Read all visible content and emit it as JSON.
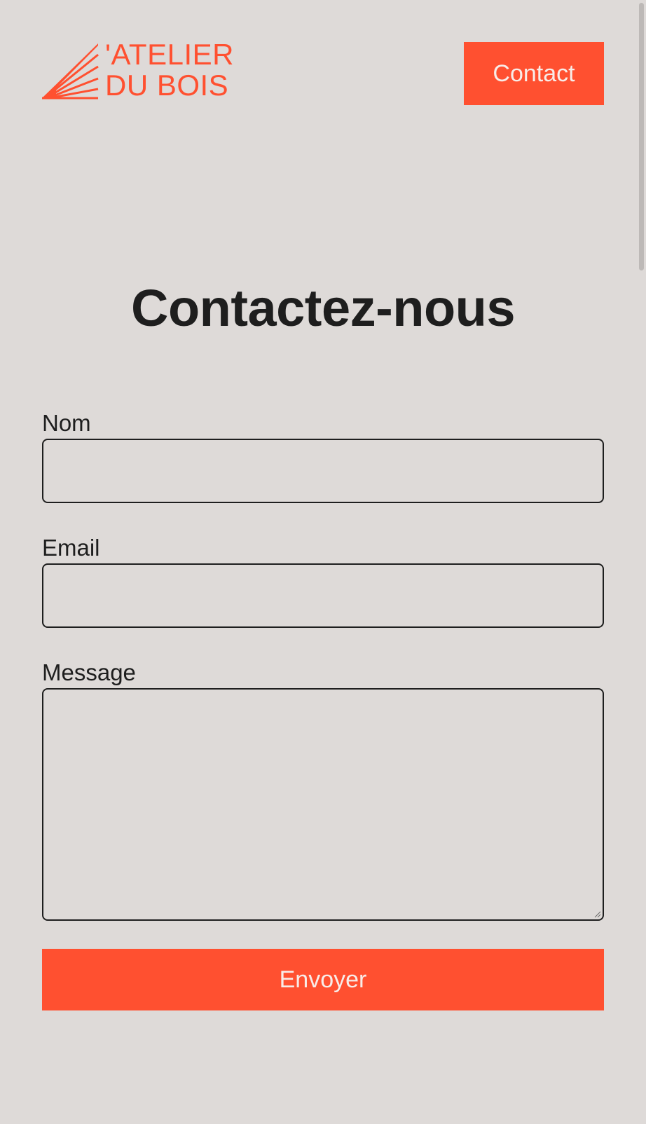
{
  "header": {
    "logo_line1": "'ATELIER",
    "logo_line2": "DU BOIS",
    "contact_label": "Contact"
  },
  "main": {
    "title": "Contactez-nous"
  },
  "form": {
    "name_label": "Nom",
    "name_value": "",
    "email_label": "Email",
    "email_value": "",
    "message_label": "Message",
    "message_value": "",
    "submit_label": "Envoyer"
  },
  "colors": {
    "accent": "#ff5030",
    "background": "#dedad8",
    "text": "#1e1e1e"
  },
  "icons": {
    "logo": "sunburst-logo-icon",
    "textarea_resize": "resize-grip-icon"
  }
}
